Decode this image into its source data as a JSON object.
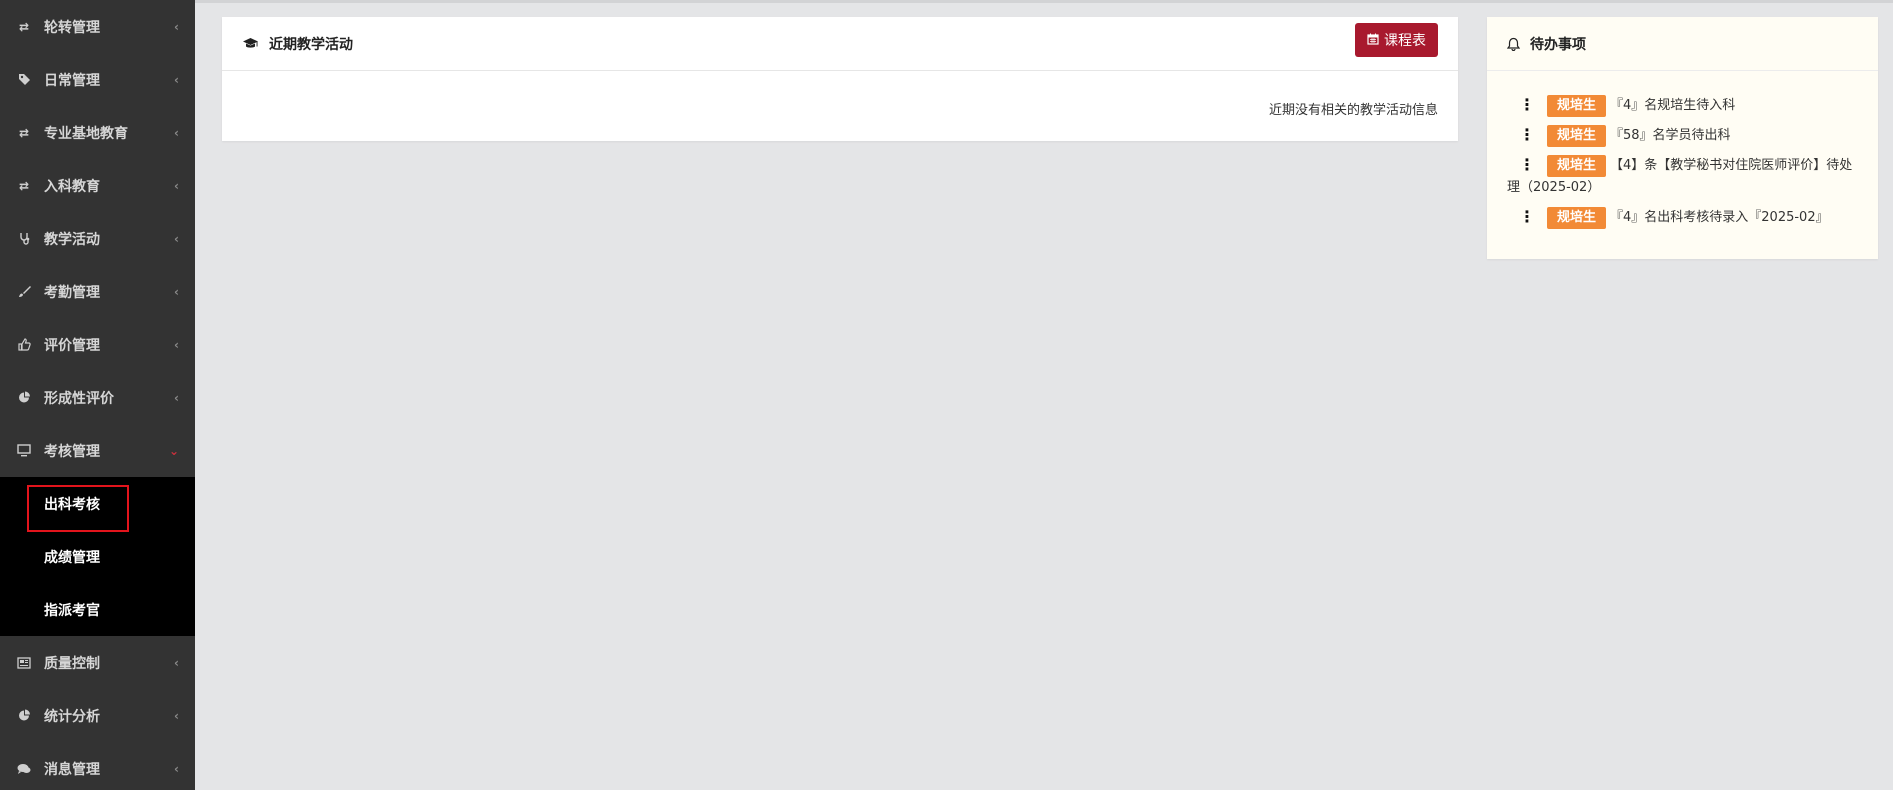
{
  "sidebar": {
    "items": [
      {
        "label": "轮转管理",
        "icon": "retweet-icon"
      },
      {
        "label": "日常管理",
        "icon": "tag-icon"
      },
      {
        "label": "专业基地教育",
        "icon": "retweet-icon"
      },
      {
        "label": "入科教育",
        "icon": "retweet-icon"
      },
      {
        "label": "教学活动",
        "icon": "stethoscope-icon"
      },
      {
        "label": "考勤管理",
        "icon": "brush-icon"
      },
      {
        "label": "评价管理",
        "icon": "thumbs-up-icon"
      },
      {
        "label": "形成性评价",
        "icon": "pie-chart-icon"
      },
      {
        "label": "考核管理",
        "icon": "desktop-icon"
      }
    ],
    "submenu": [
      {
        "label": "出科考核"
      },
      {
        "label": "成绩管理"
      },
      {
        "label": "指派考官"
      }
    ],
    "items_after": [
      {
        "label": "质量控制",
        "icon": "newspaper-icon"
      },
      {
        "label": "统计分析",
        "icon": "pie-chart-icon"
      },
      {
        "label": "消息管理",
        "icon": "comments-icon"
      }
    ]
  },
  "activity": {
    "title": "近期教学活动",
    "button_label": "课程表",
    "empty_message": "近期没有相关的教学活动信息"
  },
  "todo": {
    "title": "待办事项",
    "tag_label": "规培生",
    "items": [
      "『4』名规培生待入科",
      "『58』名学员待出科",
      "【4】条【教学秘书对住院医师评价】待处理（2025-02）",
      "『4』名出科考核待录入『2025-02』"
    ]
  },
  "colors": {
    "sidebar_bg": "#333333",
    "submenu_bg": "#000000",
    "primary_button": "#a8192e",
    "tag": "#f28a36",
    "highlight_border": "#e3141c"
  }
}
